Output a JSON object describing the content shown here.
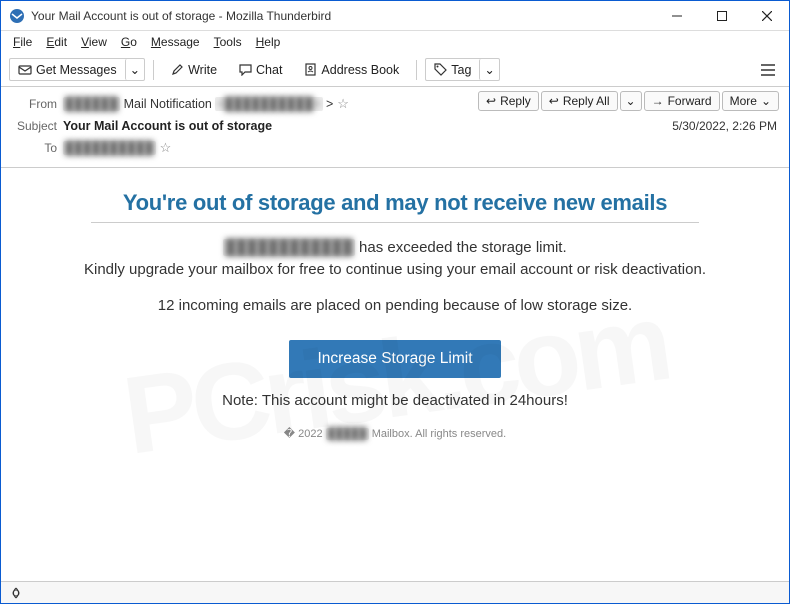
{
  "window": {
    "title": "Your Mail Account is out of storage - Mozilla Thunderbird"
  },
  "menu": {
    "file": "File",
    "edit": "Edit",
    "view": "View",
    "go": "Go",
    "message": "Message",
    "tools": "Tools",
    "help": "Help"
  },
  "toolbar": {
    "get_messages": "Get Messages",
    "write": "Write",
    "chat": "Chat",
    "address_book": "Address Book",
    "tag": "Tag"
  },
  "headers": {
    "from_label": "From",
    "from_name_hidden": "██████",
    "from_name": "Mail Notification",
    "from_addr_hidden": "<██████████>",
    "subject_label": "Subject",
    "subject": "Your Mail Account is out of storage",
    "to_label": "To",
    "to_hidden": "██████████",
    "date": "5/30/2022, 2:26 PM"
  },
  "actions": {
    "reply": "Reply",
    "reply_all": "Reply All",
    "forward": "Forward",
    "more": "More"
  },
  "body": {
    "heading": "You're out of storage and may not receive new emails",
    "line1_hidden": "████████████",
    "line1_rest": " has exceeded the storage limit.",
    "line2": "Kindly upgrade your mailbox for free to continue using your email account or risk deactivation.",
    "line3": "12 incoming emails are placed on pending because of low storage size.",
    "cta": "Increase Storage Limit",
    "note": "Note: This account might be deactivated in 24hours!",
    "footer_pre": "� 2022 ",
    "footer_hidden": "█████",
    "footer_post": " Mailbox. All rights reserved."
  }
}
